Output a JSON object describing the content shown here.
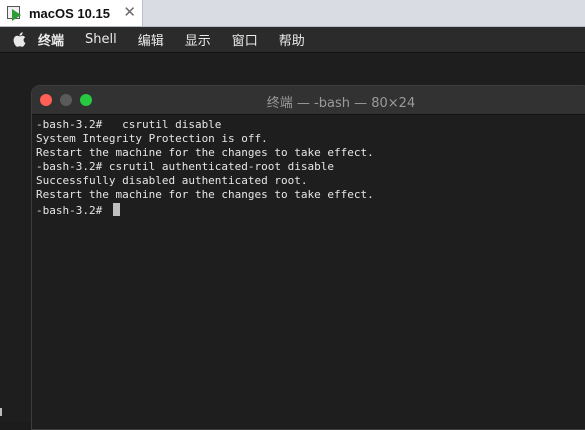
{
  "vm_tab": {
    "title": "macOS 10.15",
    "close_glyph": "✕"
  },
  "menubar": {
    "items": [
      "终端",
      "Shell",
      "编辑",
      "显示",
      "窗口",
      "帮助"
    ]
  },
  "terminal": {
    "title": "终端 — -bash — 80×24",
    "lines": [
      "-bash-3.2#   csrutil disable",
      "System Integrity Protection is off.",
      "Restart the machine for the changes to take effect.",
      "-bash-3.2# csrutil authenticated-root disable",
      "Successfully disabled authenticated root.",
      "Restart the machine for the changes to take effect.",
      "-bash-3.2# "
    ]
  },
  "colors": {
    "close": "#ff5f57",
    "minimize": "#5a5a5a",
    "zoom": "#28c840",
    "play": "#2e9b35"
  }
}
